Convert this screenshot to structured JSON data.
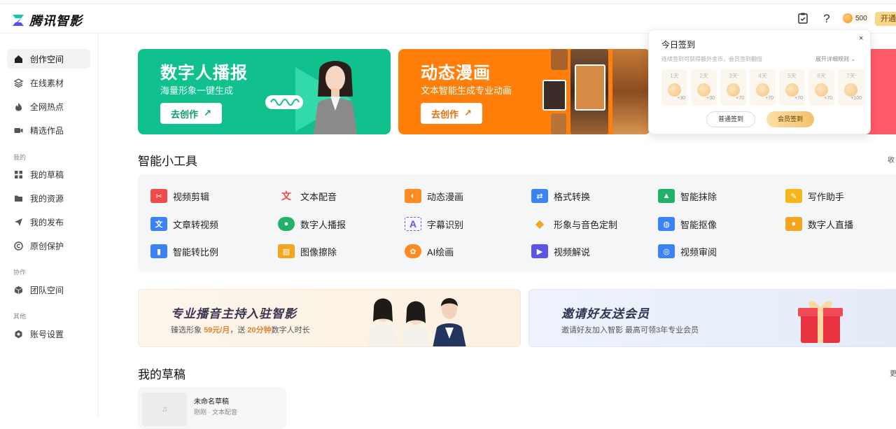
{
  "header": {
    "logo_text": "腾讯智影",
    "coins": "500",
    "open_label": "开通",
    "icons": [
      "clipboard-icon",
      "help-icon",
      "coin-icon"
    ]
  },
  "sidebar": {
    "items": [
      {
        "label": "创作空间",
        "icon": "home-icon",
        "active": true
      },
      {
        "label": "在线素材",
        "icon": "layers-icon"
      },
      {
        "label": "全网热点",
        "icon": "fire-icon"
      },
      {
        "label": "精选作品",
        "icon": "video-icon"
      }
    ],
    "group_mine": "我的",
    "mine_items": [
      {
        "label": "我的草稿",
        "icon": "grid-icon"
      },
      {
        "label": "我的资源",
        "icon": "folder-icon"
      },
      {
        "label": "我的发布",
        "icon": "send-icon"
      },
      {
        "label": "原创保护",
        "icon": "copyright-icon"
      }
    ],
    "group_collab": "协作",
    "collab_items": [
      {
        "label": "团队空间",
        "icon": "cube-icon"
      }
    ],
    "group_other": "其他",
    "other_items": [
      {
        "label": "账号设置",
        "icon": "settings-icon"
      }
    ]
  },
  "banners": [
    {
      "title": "数字人播报",
      "subtitle": "海量形象一键生成",
      "button": "去创作",
      "color": "#10c18e"
    },
    {
      "title": "动态漫画",
      "subtitle": "文本智能生成专业动画",
      "button": "去创作",
      "color": "#ff7f0a"
    }
  ],
  "tools": {
    "title": "智能小工具",
    "collapse": "收",
    "items": [
      {
        "label": "视频剪辑",
        "icon": "scissors-icon",
        "color": "#f04b4b"
      },
      {
        "label": "文本配音",
        "icon": "text-voice-icon",
        "color": "#f04b4b"
      },
      {
        "label": "动态漫画",
        "icon": "comic-icon",
        "color": "#ff8a1f"
      },
      {
        "label": "格式转换",
        "icon": "convert-icon",
        "color": "#3b82f6"
      },
      {
        "label": "智能抹除",
        "icon": "erase-icon",
        "color": "#20b26b"
      },
      {
        "label": "写作助手",
        "icon": "writing-icon",
        "color": "#f5b51b"
      },
      {
        "label": "文章转视频",
        "icon": "article-video-icon",
        "color": "#3b82f6"
      },
      {
        "label": "数字人播报",
        "icon": "avatar-broadcast-icon",
        "color": "#20b26b"
      },
      {
        "label": "字幕识别",
        "icon": "subtitle-icon",
        "color": "#6c4cf5"
      },
      {
        "label": "形象与音色定制",
        "icon": "custom-icon",
        "color": "#f5a51b"
      },
      {
        "label": "智能抠像",
        "icon": "matting-icon",
        "color": "#3b82f6"
      },
      {
        "label": "数字人直播",
        "icon": "live-icon",
        "color": "#f5a51b"
      },
      {
        "label": "智能转比例",
        "icon": "ratio-icon",
        "color": "#3b82f6"
      },
      {
        "label": "图像擦除",
        "icon": "image-erase-icon",
        "color": "#f5a51b"
      },
      {
        "label": "AI绘画",
        "icon": "palette-icon",
        "color": "#ff8a1f"
      },
      {
        "label": "视频解说",
        "icon": "video-narration-icon",
        "color": "#5b54e8"
      },
      {
        "label": "视频审阅",
        "icon": "video-review-icon",
        "color": "#3b82f6"
      }
    ]
  },
  "promos": [
    {
      "title": "专业播音主持入驻智影",
      "sub_a": "臻选形象 ",
      "sub_price": "59元/月",
      "sub_b": "，送 ",
      "sub_minutes": "20分钟",
      "sub_c": "数字人时长"
    },
    {
      "title": "邀请好友送会员",
      "sub": "邀请好友加入智影 最高可领3年专业会员"
    }
  ],
  "drafts": {
    "title": "我的草稿",
    "more": "更",
    "items": [
      {
        "name": "未命名草稿",
        "meta": "刚刚 · 文本配音"
      }
    ]
  },
  "checkin_popup": {
    "title": "今日签到",
    "close": "×",
    "desc": "连续签到可获得额外金币，会员签到翻倍",
    "rules": "展开详细规则",
    "days": [
      {
        "label": "1天",
        "amount": "+30"
      },
      {
        "label": "2天",
        "amount": "+30"
      },
      {
        "label": "3天",
        "amount": "+70"
      },
      {
        "label": "4天",
        "amount": "+70"
      },
      {
        "label": "5天",
        "amount": "+70"
      },
      {
        "label": "6天",
        "amount": "+70"
      },
      {
        "label": "7天",
        "amount": "+100"
      }
    ],
    "normal_button": "普通签到",
    "vip_button": "会员签到"
  }
}
